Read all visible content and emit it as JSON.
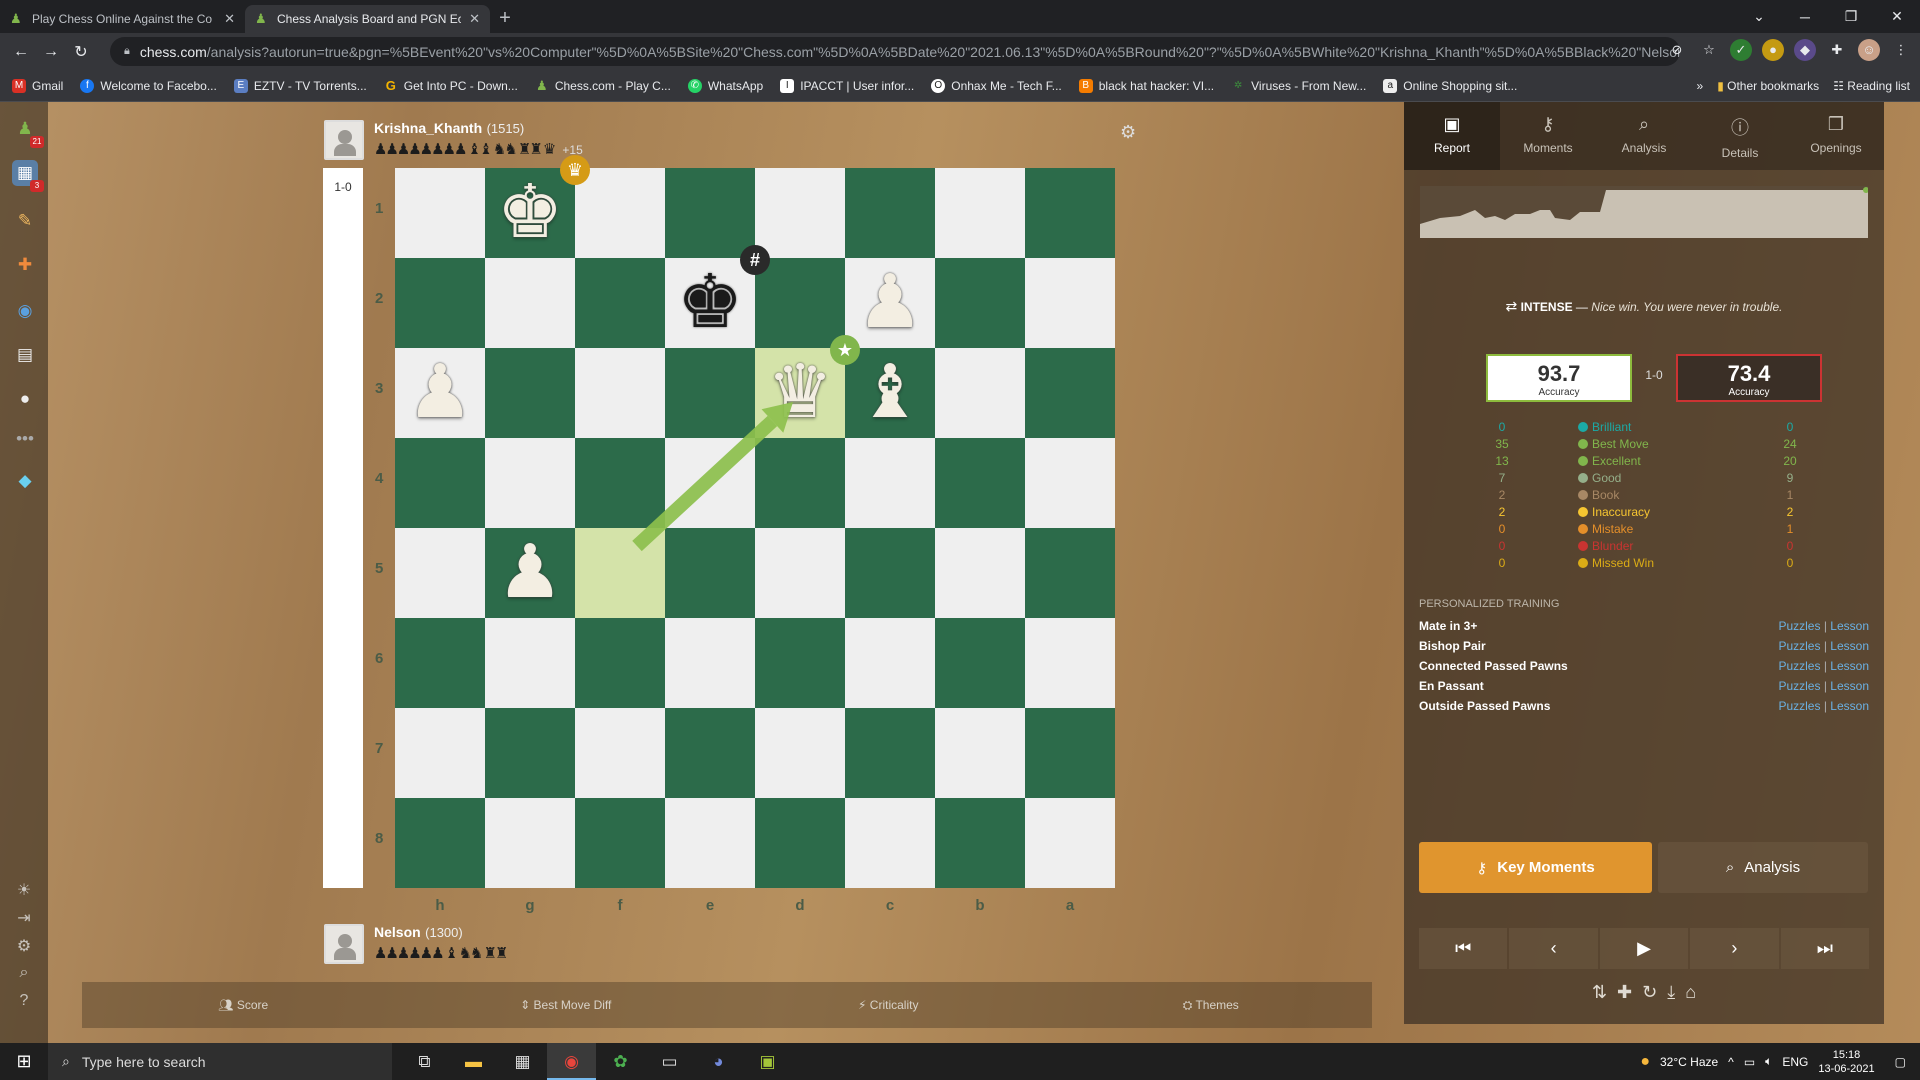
{
  "browser": {
    "tabs": [
      {
        "title": "Play Chess Online Against the Co",
        "active": false
      },
      {
        "title": "Chess Analysis Board and PGN Ec",
        "active": true
      }
    ],
    "url_host": "chess.com",
    "url_rest": "/analysis?autorun=true&pgn=%5BEvent%20\"vs%20Computer\"%5D%0A%5BSite%20\"Chess.com\"%5D%0A%5BDate%20\"2021.06.13\"%5D%0A%5BRound%20\"?\"%5D%0A%5BWhite%20\"Krishna_Khanth\"%5D%0A%5BBlack%20\"Nelson...",
    "bookmarks": [
      {
        "label": "Gmail",
        "color": "#d93025",
        "glyph": "M"
      },
      {
        "label": "Welcome to Facebo...",
        "color": "#1877f2",
        "glyph": "f"
      },
      {
        "label": "EZTV - TV Torrents...",
        "color": "#5b7ec2",
        "glyph": "E"
      },
      {
        "label": "Get Into PC - Down...",
        "color": "#f4b400",
        "glyph": "G"
      },
      {
        "label": "Chess.com - Play C...",
        "color": "#81b64c",
        "glyph": "♟"
      },
      {
        "label": "WhatsApp",
        "color": "#25d366",
        "glyph": "✆"
      },
      {
        "label": "IPACCT | User infor...",
        "color": "#444",
        "glyph": "I"
      },
      {
        "label": "Onhax Me - Tech F...",
        "color": "#222",
        "glyph": "O"
      },
      {
        "label": "black hat hacker: VI...",
        "color": "#f57c00",
        "glyph": "B"
      },
      {
        "label": "Viruses - From New...",
        "color": "#3c8c3c",
        "glyph": "v"
      },
      {
        "label": "Online Shopping sit...",
        "color": "#eee",
        "glyph": "a"
      }
    ],
    "other_bookmarks": "Other bookmarks",
    "reading_list": "Reading list"
  },
  "leftbar": {
    "badges": [
      "21",
      "3"
    ]
  },
  "players": {
    "top": {
      "name": "Krishna_Khanth",
      "rating": "(1515)",
      "captured": "♟♟♟♟♟♟♟♟ ♝♝ ♞♞ ♜♜ ♛",
      "advantage": "+15"
    },
    "bottom": {
      "name": "Nelson",
      "rating": "(1300)",
      "captured": "♟♟♟♟♟♟ ♝ ♞♞ ♜♜"
    }
  },
  "board": {
    "result": "1-0",
    "ranks": [
      "1",
      "2",
      "3",
      "4",
      "5",
      "6",
      "7",
      "8"
    ],
    "files": [
      "h",
      "g",
      "f",
      "e",
      "d",
      "c",
      "b",
      "a"
    ],
    "pieces": [
      {
        "row": 0,
        "col": 1,
        "glyph": "♚",
        "side": "w"
      },
      {
        "row": 1,
        "col": 3,
        "glyph": "♚",
        "side": "b"
      },
      {
        "row": 1,
        "col": 5,
        "glyph": "♟",
        "side": "w"
      },
      {
        "row": 2,
        "col": 0,
        "glyph": "♟",
        "side": "w"
      },
      {
        "row": 2,
        "col": 4,
        "glyph": "♛",
        "side": "w"
      },
      {
        "row": 2,
        "col": 5,
        "glyph": "♝",
        "side": "w"
      },
      {
        "row": 4,
        "col": 1,
        "glyph": "♟",
        "side": "w"
      }
    ],
    "highlight_from": {
      "row": 4,
      "col": 2
    },
    "highlight_to": {
      "row": 2,
      "col": 4
    },
    "markers": [
      {
        "type": "crown-icon",
        "glyph": "♛",
        "row": 0,
        "col": 1,
        "color": "#d59b16"
      },
      {
        "type": "checkmate-icon",
        "glyph": "#",
        "row": 1,
        "col": 3,
        "color": "#2a2a2a"
      },
      {
        "type": "best-move-icon",
        "glyph": "★",
        "row": 2,
        "col": 4,
        "color": "#81b64c"
      }
    ]
  },
  "bottom_tabs": [
    "Score",
    "Best Move Diff",
    "Criticality",
    "Themes"
  ],
  "report": {
    "tabs": [
      "Report",
      "Moments",
      "Analysis",
      "Details",
      "Openings"
    ],
    "intense_label": "INTENSE",
    "intense_note": "Nice win. You were never in trouble.",
    "accuracy_white": "93.7",
    "accuracy_black": "73.4",
    "accuracy_sub": "Accuracy",
    "score": "1-0",
    "stats": [
      {
        "label": "Brilliant",
        "white": "0",
        "black": "0",
        "color": "#1baaa6"
      },
      {
        "label": "Best Move",
        "white": "35",
        "black": "24",
        "color": "#81b64c"
      },
      {
        "label": "Excellent",
        "white": "13",
        "black": "20",
        "color": "#81b64c"
      },
      {
        "label": "Good",
        "white": "7",
        "black": "9",
        "color": "#95af8a"
      },
      {
        "label": "Book",
        "white": "2",
        "black": "1",
        "color": "#a88865"
      },
      {
        "label": "Inaccuracy",
        "white": "2",
        "black": "2",
        "color": "#f7c631"
      },
      {
        "label": "Mistake",
        "white": "0",
        "black": "1",
        "color": "#e58f2a"
      },
      {
        "label": "Blunder",
        "white": "0",
        "black": "0",
        "color": "#ca3431"
      },
      {
        "label": "Missed Win",
        "white": "0",
        "black": "0",
        "color": "#dbac16"
      }
    ],
    "training_heading": "PERSONALIZED TRAINING",
    "training": [
      "Mate in 3+",
      "Bishop Pair",
      "Connected Passed Pawns",
      "En Passant",
      "Outside Passed Pawns"
    ],
    "puzzles": "Puzzles",
    "lesson": "Lesson",
    "key_moments": "Key Moments",
    "analysis": "Analysis"
  },
  "taskbar": {
    "search_placeholder": "Type here to search",
    "weather": "32°C  Haze",
    "lang": "ENG",
    "time": "15:18",
    "date": "13-06-2021"
  }
}
